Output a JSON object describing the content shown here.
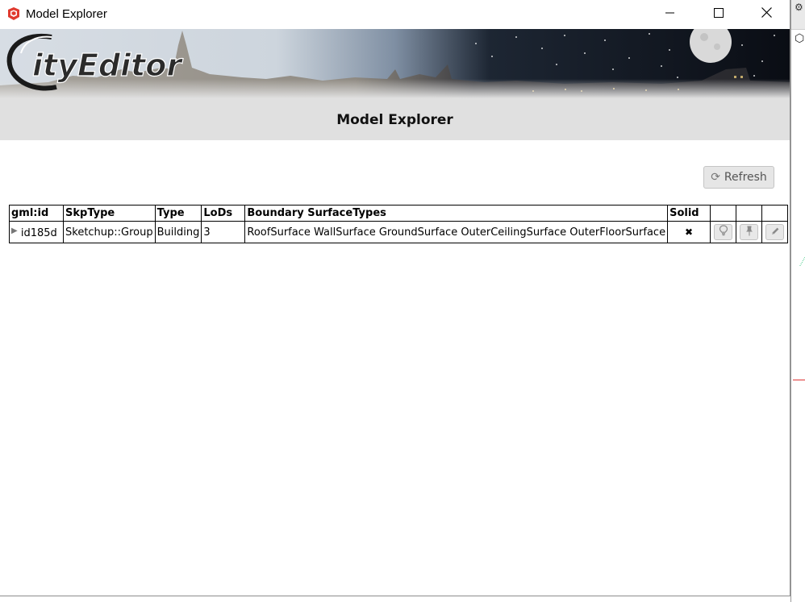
{
  "window": {
    "title": "Model Explorer"
  },
  "banner": {
    "logo_text": "CityEditor"
  },
  "header": {
    "title": "Model Explorer"
  },
  "toolbar": {
    "refresh_label": "Refresh"
  },
  "table": {
    "columns": [
      "gml:id",
      "SkpType",
      "Type",
      "LoDs",
      "Boundary SurfaceTypes",
      "Solid",
      "",
      "",
      ""
    ],
    "rows": [
      {
        "gml_id": "id185d",
        "skp_type": "Sketchup::Group",
        "type": "Building",
        "lods": "3",
        "boundary_surface_types": "RoofSurface WallSurface GroundSurface OuterCeilingSurface OuterFloorSurface",
        "solid": "✖"
      }
    ]
  },
  "icons": {
    "app": "sketchup-icon",
    "refresh": "refresh-icon",
    "expand": "expand-triangle-icon",
    "solid_false": "x-mark-icon",
    "highlight": "lightbulb-icon",
    "pin": "pin-icon",
    "edit": "pencil-icon"
  },
  "colors": {
    "header_band": "#e0e0e0",
    "button_bg": "#e6e6e6",
    "app_icon_red": "#e03a2f"
  }
}
